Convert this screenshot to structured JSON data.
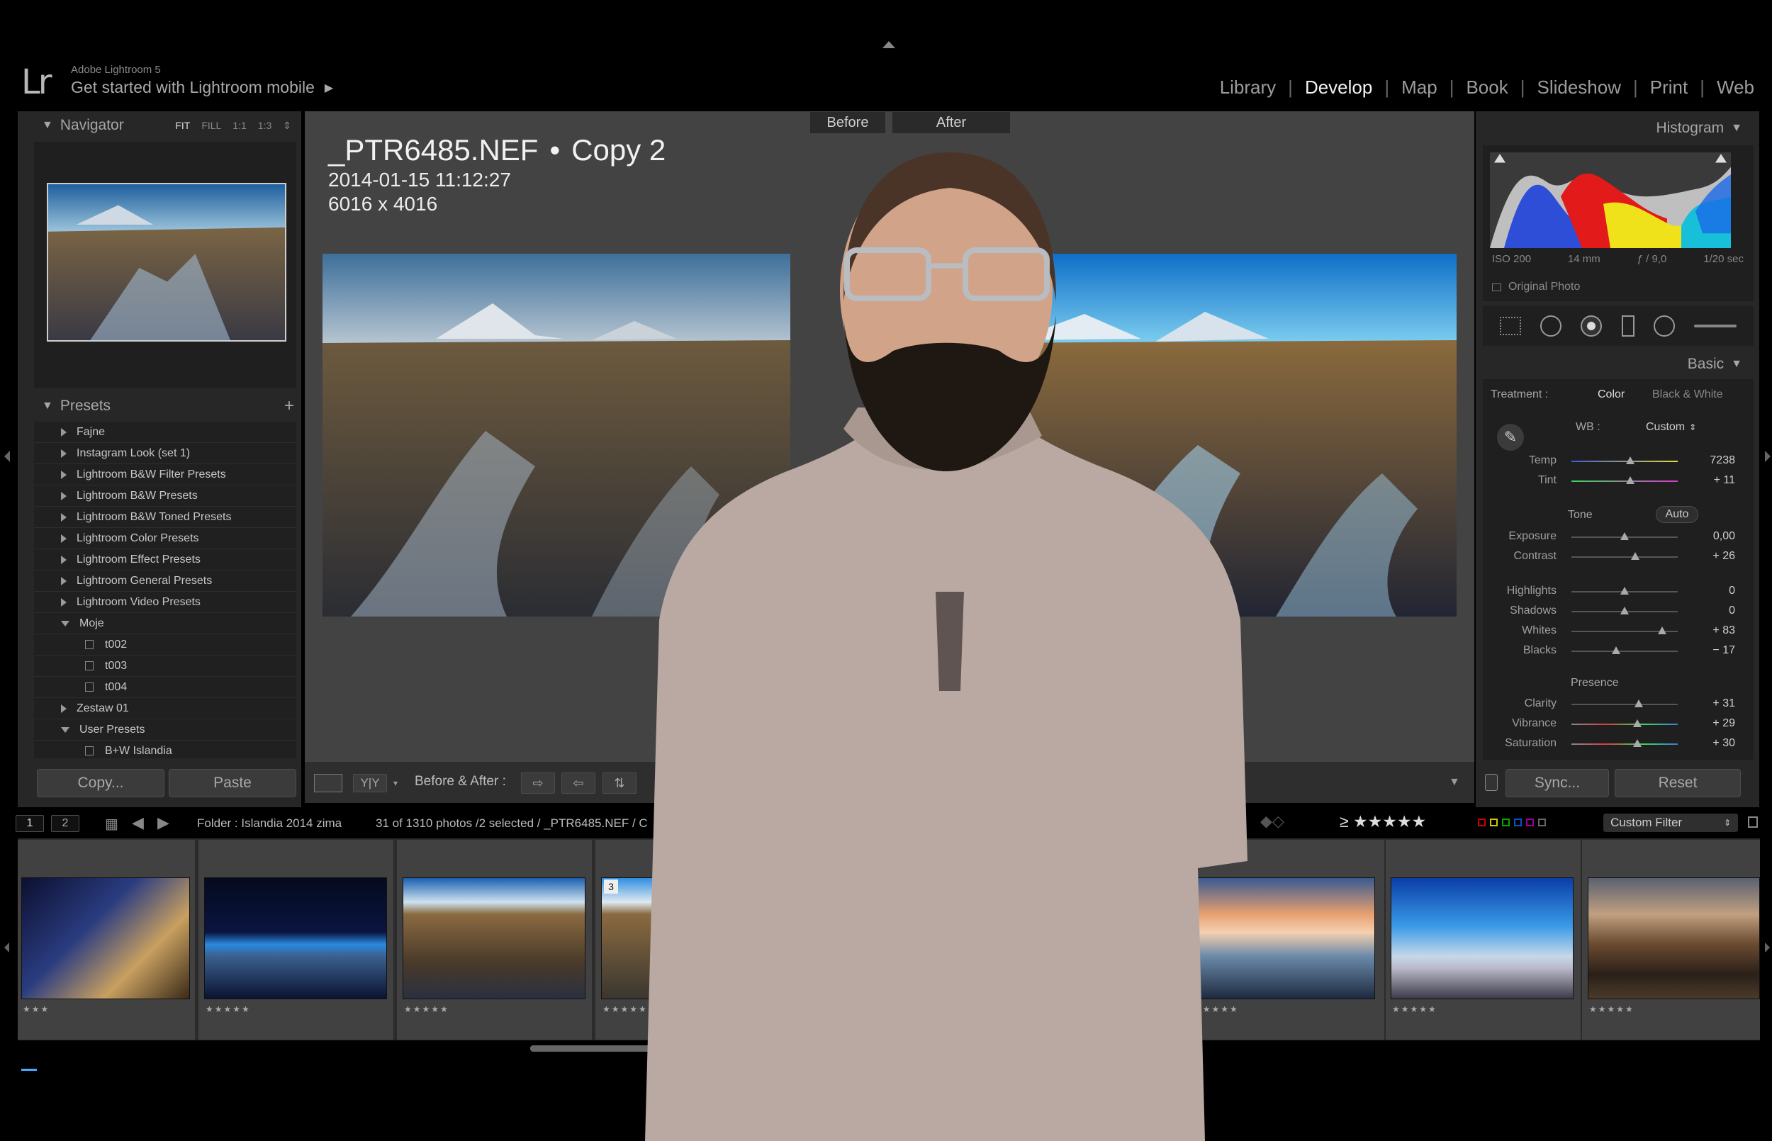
{
  "app": {
    "version": "Adobe Lightroom 5",
    "mobile_link": "Get started with Lightroom mobile",
    "logo": "Lr"
  },
  "modules": [
    {
      "label": "Library",
      "active": false
    },
    {
      "label": "Develop",
      "active": true
    },
    {
      "label": "Map",
      "active": false
    },
    {
      "label": "Book",
      "active": false
    },
    {
      "label": "Slideshow",
      "active": false
    },
    {
      "label": "Print",
      "active": false
    },
    {
      "label": "Web",
      "active": false
    }
  ],
  "navigator": {
    "title": "Navigator",
    "zoom": [
      "FIT",
      "FILL",
      "1:1",
      "1:3"
    ],
    "selected_zoom": "FIT"
  },
  "presets": {
    "title": "Presets",
    "add": "+",
    "items": [
      {
        "label": "Fajne",
        "type": "folder",
        "open": false
      },
      {
        "label": "Instagram Look (set 1)",
        "type": "folder",
        "open": false
      },
      {
        "label": "Lightroom B&W Filter Presets",
        "type": "folder",
        "open": false
      },
      {
        "label": "Lightroom B&W Presets",
        "type": "folder",
        "open": false
      },
      {
        "label": "Lightroom B&W Toned Presets",
        "type": "folder",
        "open": false
      },
      {
        "label": "Lightroom Color Presets",
        "type": "folder",
        "open": false
      },
      {
        "label": "Lightroom Effect Presets",
        "type": "folder",
        "open": false
      },
      {
        "label": "Lightroom General Presets",
        "type": "folder",
        "open": false
      },
      {
        "label": "Lightroom Video Presets",
        "type": "folder",
        "open": false
      },
      {
        "label": "Moje",
        "type": "folder",
        "open": true
      },
      {
        "label": "t002",
        "type": "preset"
      },
      {
        "label": "t003",
        "type": "preset"
      },
      {
        "label": "t004",
        "type": "preset"
      },
      {
        "label": "Zestaw 01",
        "type": "folder",
        "open": false
      },
      {
        "label": "User Presets",
        "type": "folder",
        "open": true
      },
      {
        "label": "B+W Islandia",
        "type": "preset"
      }
    ]
  },
  "left_buttons": {
    "copy": "Copy...",
    "paste": "Paste"
  },
  "image": {
    "filename": "_PTR6485.NEF",
    "bullet": "•",
    "copy": "Copy 2",
    "date": "2014-01-15 11:12:27",
    "dimensions": "6016 x 4016"
  },
  "compare": {
    "before": "Before",
    "after": "After"
  },
  "toolbar": {
    "view_yy": "Y|Y",
    "before_after": "Before & After :"
  },
  "histogram": {
    "title": "Histogram",
    "iso": "ISO 200",
    "focal": "14 mm",
    "aperture": "ƒ / 9,0",
    "shutter": "1/20 sec",
    "original_photo": "Original Photo"
  },
  "basic": {
    "title": "Basic",
    "treatment_label": "Treatment :",
    "color": "Color",
    "bw": "Black & White",
    "wb_label": "WB :",
    "wb_value": "Custom",
    "tone_label": "Tone",
    "auto": "Auto",
    "presence_label": "Presence",
    "sliders": [
      {
        "label": "Temp",
        "value": "7238",
        "pos": 0.55
      },
      {
        "label": "Tint",
        "value": "+ 11",
        "pos": 0.55
      },
      {
        "label": "Exposure",
        "value": "0,00",
        "pos": 0.5
      },
      {
        "label": "Contrast",
        "value": "+ 26",
        "pos": 0.6
      },
      {
        "label": "Highlights",
        "value": "0",
        "pos": 0.5
      },
      {
        "label": "Shadows",
        "value": "0",
        "pos": 0.5
      },
      {
        "label": "Whites",
        "value": "+ 83",
        "pos": 0.85
      },
      {
        "label": "Blacks",
        "value": "− 17",
        "pos": 0.42
      },
      {
        "label": "Clarity",
        "value": "+ 31",
        "pos": 0.63
      },
      {
        "label": "Vibrance",
        "value": "+ 29",
        "pos": 0.62
      },
      {
        "label": "Saturation",
        "value": "+ 30",
        "pos": 0.62
      }
    ]
  },
  "right_buttons": {
    "sync": "Sync...",
    "reset": "Reset"
  },
  "filmbar": {
    "page1": "1",
    "page2": "2",
    "folder": "Folder : Islandia 2014 zima",
    "count": "31 of 1310 photos /2 selected / _PTR6485.NEF / C",
    "rating_filter": "≥ ★★★★★",
    "custom_filter": "Custom Filter"
  },
  "filmstrip": [
    {
      "stars": "★★★",
      "badge": ""
    },
    {
      "stars": "★★★★★",
      "badge": ""
    },
    {
      "stars": "★★★★★",
      "badge": ""
    },
    {
      "stars": "★★★★★",
      "badge": "3"
    },
    {
      "stars": "★★★★★",
      "badge": ""
    },
    {
      "stars": "★★★★★",
      "badge": ""
    },
    {
      "stars": "★★★★★",
      "badge": ""
    }
  ],
  "colors": {
    "accent": "#f2f2f2",
    "panel": "#272727",
    "center": "#434343"
  }
}
